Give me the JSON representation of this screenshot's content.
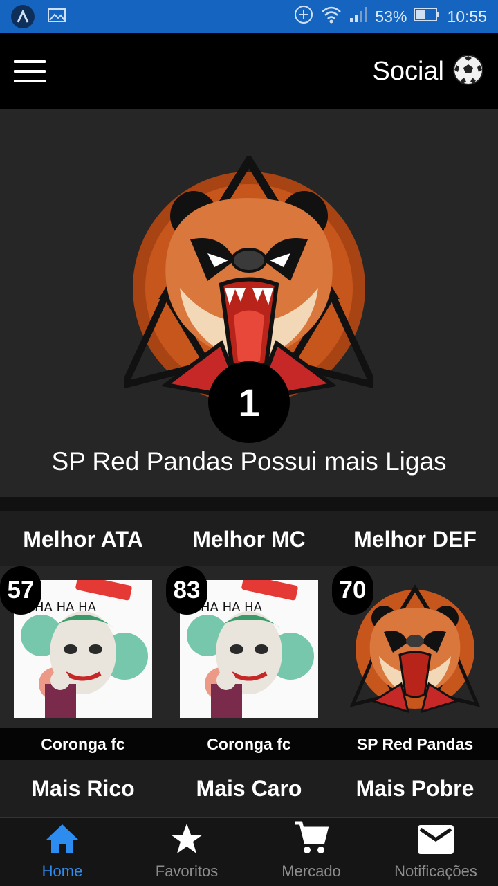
{
  "status_bar": {
    "battery": "53%",
    "time": "10:55"
  },
  "app_bar": {
    "title": "Social",
    "title_icon": "soccer-ball-icon",
    "menu_icon": "hamburger-menu-icon"
  },
  "hero": {
    "rank": "1",
    "caption": "SP Red Pandas Possui mais Ligas",
    "logo_icon": "red-panda-logo"
  },
  "best": {
    "labels": [
      "Melhor ATA",
      "Melhor MC",
      "Melhor DEF"
    ],
    "cards": [
      {
        "score": "57",
        "team": "Coronga fc",
        "image": "joker-image"
      },
      {
        "score": "83",
        "team": "Coronga fc",
        "image": "joker-image"
      },
      {
        "score": "70",
        "team": "SP Red Pandas",
        "image": "red-panda-logo"
      }
    ]
  },
  "more": {
    "labels": [
      "Mais Rico",
      "Mais Caro",
      "Mais Pobre"
    ]
  },
  "bottom_nav": {
    "items": [
      {
        "label": "Home",
        "icon": "home-icon",
        "active": true
      },
      {
        "label": "Favoritos",
        "icon": "star-icon",
        "active": false
      },
      {
        "label": "Mercado",
        "icon": "cart-icon",
        "active": false
      },
      {
        "label": "Notificações",
        "icon": "mail-icon",
        "active": false
      }
    ]
  },
  "colors": {
    "status_bar": "#1565c0",
    "accent": "#2d8cf0",
    "background": "#262626"
  }
}
